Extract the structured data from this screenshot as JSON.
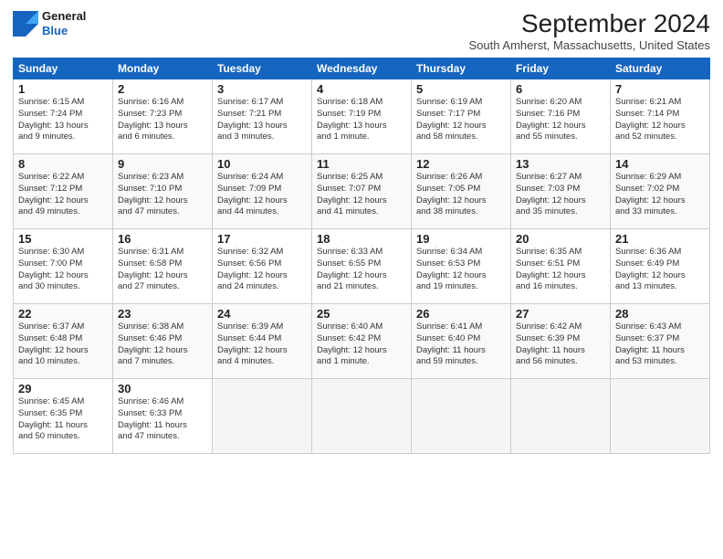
{
  "logo": {
    "line1": "General",
    "line2": "Blue"
  },
  "title": "September 2024",
  "location": "South Amherst, Massachusetts, United States",
  "weekdays": [
    "Sunday",
    "Monday",
    "Tuesday",
    "Wednesday",
    "Thursday",
    "Friday",
    "Saturday"
  ],
  "weeks": [
    [
      {
        "day": 1,
        "info": "Sunrise: 6:15 AM\nSunset: 7:24 PM\nDaylight: 13 hours\nand 9 minutes."
      },
      {
        "day": 2,
        "info": "Sunrise: 6:16 AM\nSunset: 7:23 PM\nDaylight: 13 hours\nand 6 minutes."
      },
      {
        "day": 3,
        "info": "Sunrise: 6:17 AM\nSunset: 7:21 PM\nDaylight: 13 hours\nand 3 minutes."
      },
      {
        "day": 4,
        "info": "Sunrise: 6:18 AM\nSunset: 7:19 PM\nDaylight: 13 hours\nand 1 minute."
      },
      {
        "day": 5,
        "info": "Sunrise: 6:19 AM\nSunset: 7:17 PM\nDaylight: 12 hours\nand 58 minutes."
      },
      {
        "day": 6,
        "info": "Sunrise: 6:20 AM\nSunset: 7:16 PM\nDaylight: 12 hours\nand 55 minutes."
      },
      {
        "day": 7,
        "info": "Sunrise: 6:21 AM\nSunset: 7:14 PM\nDaylight: 12 hours\nand 52 minutes."
      }
    ],
    [
      {
        "day": 8,
        "info": "Sunrise: 6:22 AM\nSunset: 7:12 PM\nDaylight: 12 hours\nand 49 minutes."
      },
      {
        "day": 9,
        "info": "Sunrise: 6:23 AM\nSunset: 7:10 PM\nDaylight: 12 hours\nand 47 minutes."
      },
      {
        "day": 10,
        "info": "Sunrise: 6:24 AM\nSunset: 7:09 PM\nDaylight: 12 hours\nand 44 minutes."
      },
      {
        "day": 11,
        "info": "Sunrise: 6:25 AM\nSunset: 7:07 PM\nDaylight: 12 hours\nand 41 minutes."
      },
      {
        "day": 12,
        "info": "Sunrise: 6:26 AM\nSunset: 7:05 PM\nDaylight: 12 hours\nand 38 minutes."
      },
      {
        "day": 13,
        "info": "Sunrise: 6:27 AM\nSunset: 7:03 PM\nDaylight: 12 hours\nand 35 minutes."
      },
      {
        "day": 14,
        "info": "Sunrise: 6:29 AM\nSunset: 7:02 PM\nDaylight: 12 hours\nand 33 minutes."
      }
    ],
    [
      {
        "day": 15,
        "info": "Sunrise: 6:30 AM\nSunset: 7:00 PM\nDaylight: 12 hours\nand 30 minutes."
      },
      {
        "day": 16,
        "info": "Sunrise: 6:31 AM\nSunset: 6:58 PM\nDaylight: 12 hours\nand 27 minutes."
      },
      {
        "day": 17,
        "info": "Sunrise: 6:32 AM\nSunset: 6:56 PM\nDaylight: 12 hours\nand 24 minutes."
      },
      {
        "day": 18,
        "info": "Sunrise: 6:33 AM\nSunset: 6:55 PM\nDaylight: 12 hours\nand 21 minutes."
      },
      {
        "day": 19,
        "info": "Sunrise: 6:34 AM\nSunset: 6:53 PM\nDaylight: 12 hours\nand 19 minutes."
      },
      {
        "day": 20,
        "info": "Sunrise: 6:35 AM\nSunset: 6:51 PM\nDaylight: 12 hours\nand 16 minutes."
      },
      {
        "day": 21,
        "info": "Sunrise: 6:36 AM\nSunset: 6:49 PM\nDaylight: 12 hours\nand 13 minutes."
      }
    ],
    [
      {
        "day": 22,
        "info": "Sunrise: 6:37 AM\nSunset: 6:48 PM\nDaylight: 12 hours\nand 10 minutes."
      },
      {
        "day": 23,
        "info": "Sunrise: 6:38 AM\nSunset: 6:46 PM\nDaylight: 12 hours\nand 7 minutes."
      },
      {
        "day": 24,
        "info": "Sunrise: 6:39 AM\nSunset: 6:44 PM\nDaylight: 12 hours\nand 4 minutes."
      },
      {
        "day": 25,
        "info": "Sunrise: 6:40 AM\nSunset: 6:42 PM\nDaylight: 12 hours\nand 1 minute."
      },
      {
        "day": 26,
        "info": "Sunrise: 6:41 AM\nSunset: 6:40 PM\nDaylight: 11 hours\nand 59 minutes."
      },
      {
        "day": 27,
        "info": "Sunrise: 6:42 AM\nSunset: 6:39 PM\nDaylight: 11 hours\nand 56 minutes."
      },
      {
        "day": 28,
        "info": "Sunrise: 6:43 AM\nSunset: 6:37 PM\nDaylight: 11 hours\nand 53 minutes."
      }
    ],
    [
      {
        "day": 29,
        "info": "Sunrise: 6:45 AM\nSunset: 6:35 PM\nDaylight: 11 hours\nand 50 minutes."
      },
      {
        "day": 30,
        "info": "Sunrise: 6:46 AM\nSunset: 6:33 PM\nDaylight: 11 hours\nand 47 minutes."
      },
      {
        "day": null,
        "info": ""
      },
      {
        "day": null,
        "info": ""
      },
      {
        "day": null,
        "info": ""
      },
      {
        "day": null,
        "info": ""
      },
      {
        "day": null,
        "info": ""
      }
    ]
  ]
}
